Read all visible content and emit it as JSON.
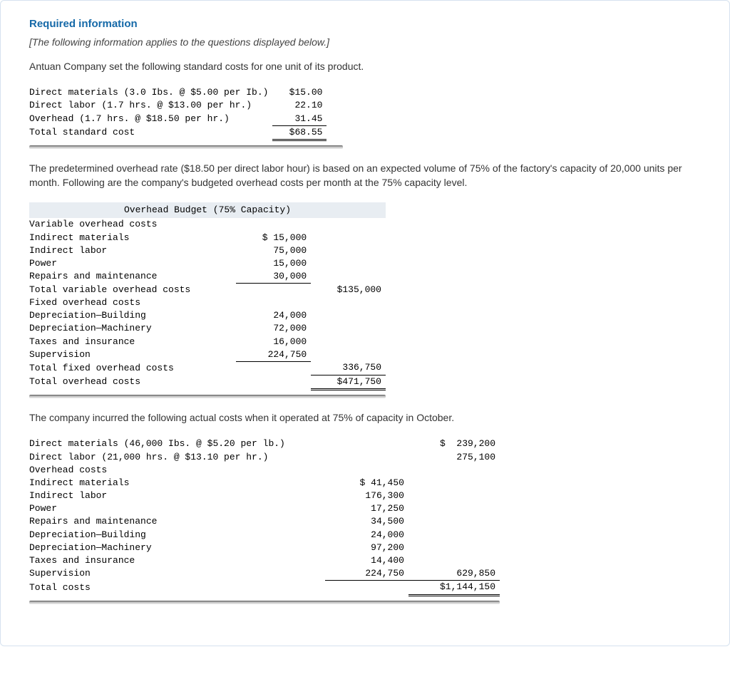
{
  "heading": "Required information",
  "intro_italic": "[The following information applies to the questions displayed below.]",
  "para1": "Antuan Company set the following standard costs for one unit of its product.",
  "std_cost": {
    "rows": [
      {
        "label": "Direct materials (3.0 Ibs. @ $5.00 per Ib.)",
        "amt": "$15.00"
      },
      {
        "label": "Direct labor (1.7 hrs. @ $13.00 per hr.)",
        "amt": "22.10"
      },
      {
        "label": "Overhead (1.7 hrs. @ $18.50 per hr.)",
        "amt": "31.45"
      }
    ],
    "total_label": "Total standard cost",
    "total_amt": "$68.55"
  },
  "para2": "The predetermined overhead rate ($18.50 per direct labor hour) is based on an expected volume of 75% of the factory's capacity of 20,000 units per month. Following are the company's budgeted overhead costs per month at the 75% capacity level.",
  "budget": {
    "title": "Overhead Budget (75% Capacity)",
    "var_head": "Variable overhead costs",
    "var_rows": [
      {
        "label": "Indirect materials",
        "amt": "$ 15,000"
      },
      {
        "label": "Indirect labor",
        "amt": "75,000"
      },
      {
        "label": "Power",
        "amt": "15,000"
      },
      {
        "label": "Repairs and maintenance",
        "amt": "30,000"
      }
    ],
    "var_total_label": "Total variable overhead costs",
    "var_total_amt": "$135,000",
    "fix_head": "Fixed overhead costs",
    "fix_rows": [
      {
        "label": "Depreciation—Building",
        "amt": "24,000"
      },
      {
        "label": "Depreciation—Machinery",
        "amt": "72,000"
      },
      {
        "label": "Taxes and insurance",
        "amt": "16,000"
      },
      {
        "label": "Supervision",
        "amt": "224,750"
      }
    ],
    "fix_total_label": "Total fixed overhead costs",
    "fix_total_amt": "336,750",
    "grand_label": "Total overhead costs",
    "grand_amt": "$471,750"
  },
  "para3": "The company incurred the following actual costs when it operated at 75% of capacity in October.",
  "actual": {
    "top": [
      {
        "label": "Direct materials (46,000 Ibs. @ $5.20 per lb.)",
        "amt": "$  239,200"
      },
      {
        "label": "Direct labor (21,000 hrs. @ $13.10 per hr.)",
        "amt": "275,100"
      }
    ],
    "oh_label": "Overhead costs",
    "oh_rows": [
      {
        "label": "Indirect materials",
        "amt": "$ 41,450"
      },
      {
        "label": "Indirect labor",
        "amt": "176,300"
      },
      {
        "label": "Power",
        "amt": "17,250"
      },
      {
        "label": "Repairs and maintenance",
        "amt": "34,500"
      },
      {
        "label": "Depreciation—Building",
        "amt": "24,000"
      },
      {
        "label": "Depreciation—Machinery",
        "amt": "97,200"
      },
      {
        "label": "Taxes and insurance",
        "amt": "14,400"
      },
      {
        "label": "Supervision",
        "amt": "224,750"
      }
    ],
    "oh_total": "629,850",
    "total_label": "Total costs",
    "total_amt": "$1,144,150"
  }
}
